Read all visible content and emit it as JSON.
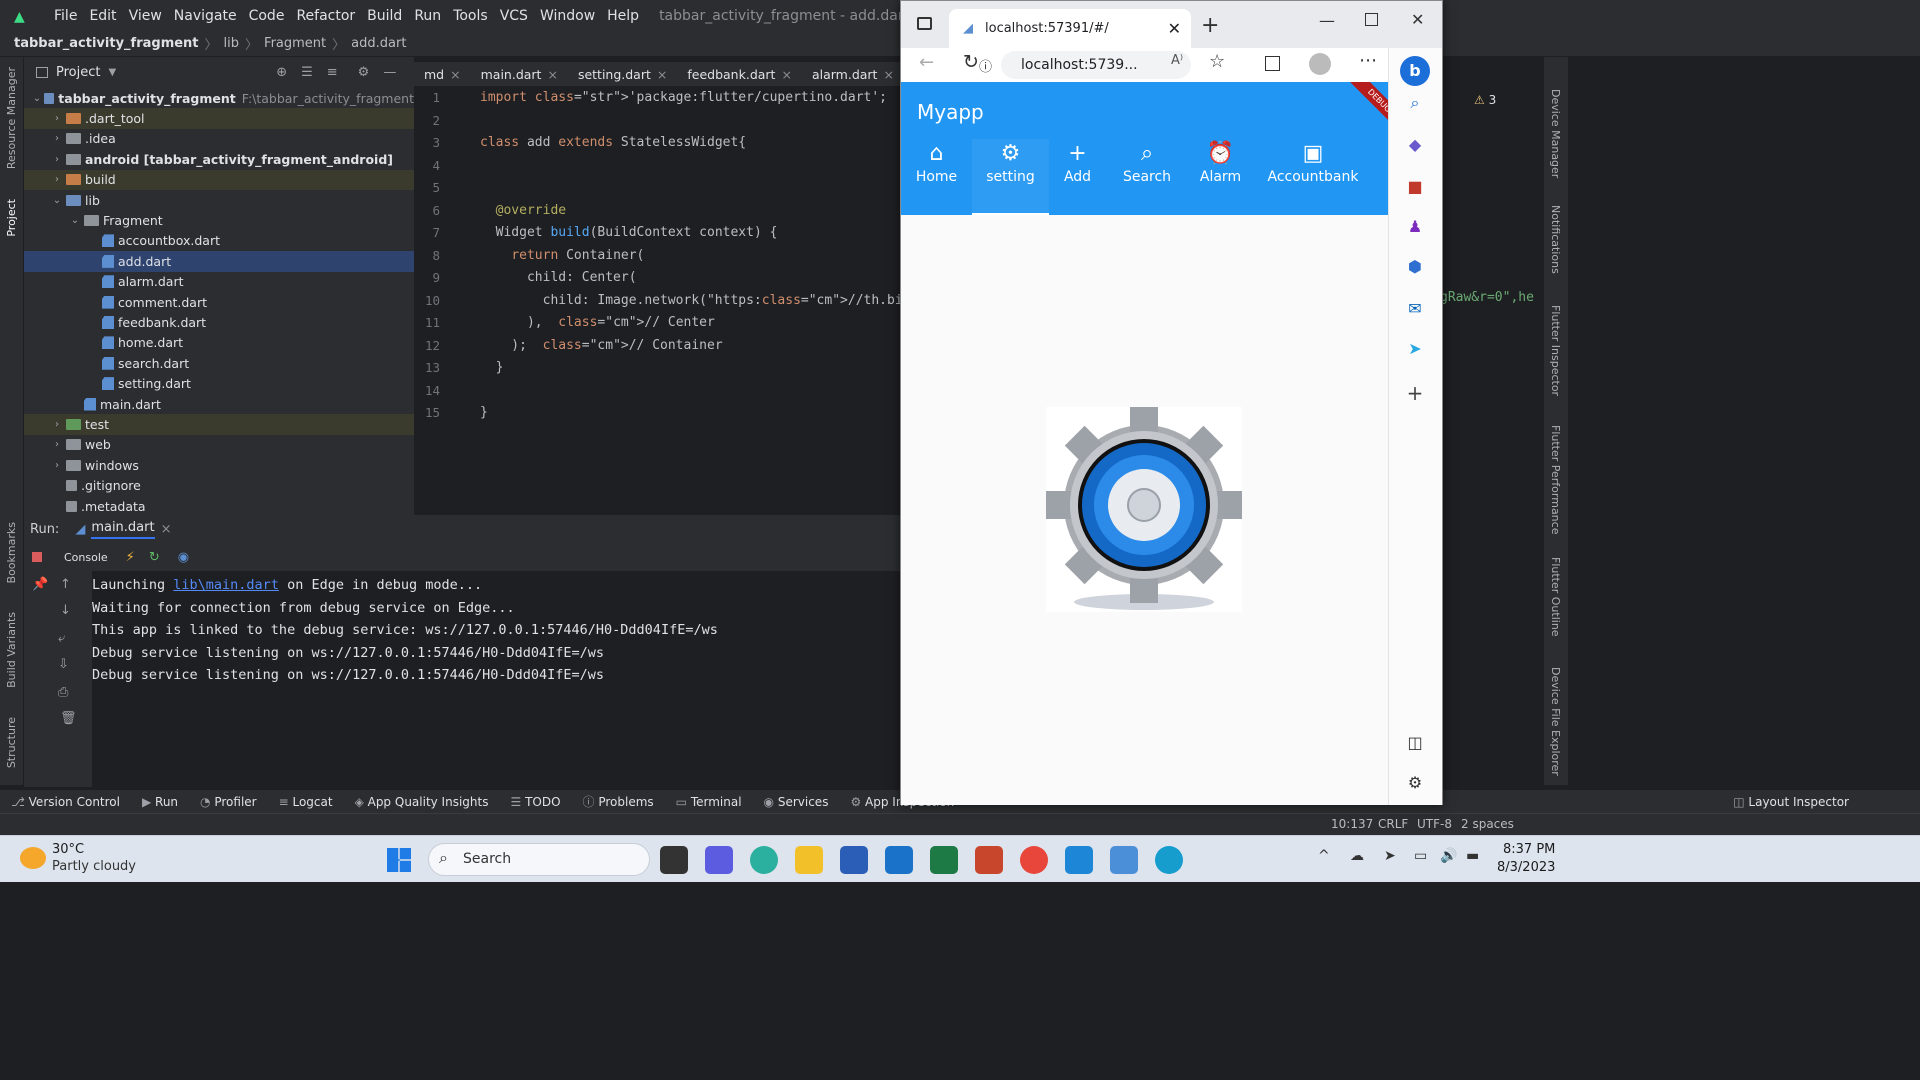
{
  "ide": {
    "menu": [
      "File",
      "Edit",
      "View",
      "Navigate",
      "Code",
      "Refactor",
      "Build",
      "Run",
      "Tools",
      "VCS",
      "Window",
      "Help"
    ],
    "window_title": "tabbar_activity_fragment - add.dart [tabbar_activity_fragme",
    "breadcrumb": [
      "tabbar_activity_fragment",
      "lib",
      "Fragment",
      "add.dart"
    ],
    "project_header": "Project",
    "tree": [
      {
        "label": "tabbar_activity_fragment",
        "note": "F:\\tabbar_activity_fragment",
        "kind": "root",
        "indent": 0,
        "arrow": "down"
      },
      {
        "label": ".dart_tool",
        "kind": "folder-orange",
        "indent": 1,
        "arrow": "right",
        "hl": true
      },
      {
        "label": ".idea",
        "kind": "folder-grey",
        "indent": 1,
        "arrow": "right"
      },
      {
        "label": "android [tabbar_activity_fragment_android]",
        "kind": "folder-grey",
        "indent": 1,
        "arrow": "right",
        "bold": true
      },
      {
        "label": "build",
        "kind": "folder-orange",
        "indent": 1,
        "arrow": "right",
        "hl": true
      },
      {
        "label": "lib",
        "kind": "folder-blue",
        "indent": 1,
        "arrow": "down"
      },
      {
        "label": "Fragment",
        "kind": "folder-grey",
        "indent": 2,
        "arrow": "down"
      },
      {
        "label": "accountbox.dart",
        "kind": "dart",
        "indent": 3
      },
      {
        "label": "add.dart",
        "kind": "dart",
        "indent": 3,
        "sel": true
      },
      {
        "label": "alarm.dart",
        "kind": "dart",
        "indent": 3
      },
      {
        "label": "comment.dart",
        "kind": "dart",
        "indent": 3
      },
      {
        "label": "feedbank.dart",
        "kind": "dart",
        "indent": 3
      },
      {
        "label": "home.dart",
        "kind": "dart",
        "indent": 3
      },
      {
        "label": "search.dart",
        "kind": "dart",
        "indent": 3
      },
      {
        "label": "setting.dart",
        "kind": "dart",
        "indent": 3
      },
      {
        "label": "main.dart",
        "kind": "dart",
        "indent": 2
      },
      {
        "label": "test",
        "kind": "folder-green",
        "indent": 1,
        "arrow": "right",
        "hl": true
      },
      {
        "label": "web",
        "kind": "folder-grey",
        "indent": 1,
        "arrow": "right"
      },
      {
        "label": "windows",
        "kind": "folder-grey",
        "indent": 1,
        "arrow": "right"
      },
      {
        "label": ".gitignore",
        "kind": "file",
        "indent": 1
      },
      {
        "label": ".metadata",
        "kind": "file",
        "indent": 1
      }
    ],
    "editor_tabs": [
      "md",
      "main.dart",
      "setting.dart",
      "feedbank.dart",
      "alarm.dart"
    ],
    "code_lines": [
      "import 'package:flutter/cupertino.dart';",
      "",
      "class add extends StatelessWidget{",
      "",
      "",
      "  @override",
      "  Widget build(BuildContext context) {",
      "    return Container(",
      "      child: Center(",
      "        child: Image.network(\"https://th.bing.com/th",
      "      ),  // Center",
      "    );  // Container",
      "  }",
      "",
      "}"
    ],
    "code_overflow": "gRaw&r=0\",he",
    "run_label": "Run:",
    "run_tab": "main.dart",
    "console_tab": "Console",
    "console_lines": [
      "Waiting for connection from debug service on Edge...",
      "This app is linked to the debug service: ws://127.0.0.1:57446/H0-Ddd04IfE=/ws",
      "Debug service listening on ws://127.0.0.1:57446/H0-Ddd04IfE=/ws",
      "Debug service listening on ws://127.0.0.1:57446/H0-Ddd04IfE=/ws"
    ],
    "console_launch": {
      "pre": "Launching ",
      "link": "lib\\main.dart",
      "post": " on Edge in debug mode..."
    },
    "left_strip": [
      "Resource Manager",
      "Project",
      "Bookmarks",
      "Build Variants",
      "Structure"
    ],
    "right_strip": [
      "Device Manager",
      "Notifications",
      "Flutter Inspector",
      "Flutter Performance",
      "Flutter Outline",
      "Device File Explorer"
    ],
    "bottom_tools": [
      "Version Control",
      "Run",
      "Profiler",
      "Logcat",
      "App Quality Insights",
      "TODO",
      "Problems",
      "Terminal",
      "Services",
      "App Inspection",
      "Layout Inspector"
    ],
    "status": {
      "position": "10:137",
      "line_sep": "CRLF",
      "encoding": "UTF-8",
      "indent": "2 spaces"
    },
    "problems_count": "3"
  },
  "browser": {
    "tab_title": "localhost:57391/#/",
    "url": "localhost:5739...",
    "app_title": "Myapp",
    "debug_banner": "DEBUG",
    "nav_tabs": [
      {
        "label": "Home",
        "icon": "home-icon",
        "glyph": "⌂"
      },
      {
        "label": "setting",
        "icon": "gear-icon",
        "glyph": "⚙",
        "active": true
      },
      {
        "label": "Add",
        "icon": "plus-icon",
        "glyph": "+"
      },
      {
        "label": "Search",
        "icon": "search-icon",
        "glyph": "⌕"
      },
      {
        "label": "Alarm",
        "icon": "alarm-icon",
        "glyph": "⏰"
      },
      {
        "label": "Accountbank",
        "icon": "account-box-icon",
        "glyph": "▣"
      }
    ],
    "colors": {
      "appbar": "#2196f3",
      "debug": "#b71c1c"
    }
  },
  "taskbar": {
    "weather_temp": "30°C",
    "weather_desc": "Partly cloudy",
    "search": "Search",
    "time": "8:37 PM",
    "date": "8/3/2023"
  }
}
